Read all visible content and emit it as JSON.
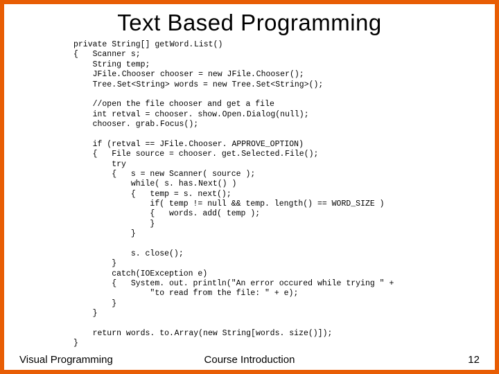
{
  "title": "Text Based Programming",
  "code": "private String[] get Word. List()\n{   Scanner s;\n    String temp;\n    JFile. Chooser chooser = new JFile. Chooser();\n    Tree. Set<String> words = new Tree. Set<String>();\n\n    //open the file chooser and get a file\n    int retval = chooser. show. Open. Dialog(null);\n    chooser. grab. Focus();\n\n    if (retval == JFile. Chooser. APPROVE_OPTION)\n    {   File source = chooser. get. Selected. File();\n        try\n        {   s = new Scanner( source );\n            while( s. has. Next() )\n            {   temp = s. next();\n                if( temp != null && temp. length() == WORD_SIZE )\n                {   words. add( temp );\n                }\n            }\n\n            s. close();\n        }\n        catch(IOException e)\n        {   System. out. println(\"An error occured while trying \" +\n                \"to read from the file: \" + e);\n        }\n    }\n\n    return words. to. Array(new String[words. size()]);\n}",
  "footer": {
    "left": "Visual Programming",
    "center": "Course Introduction",
    "page": "12"
  }
}
